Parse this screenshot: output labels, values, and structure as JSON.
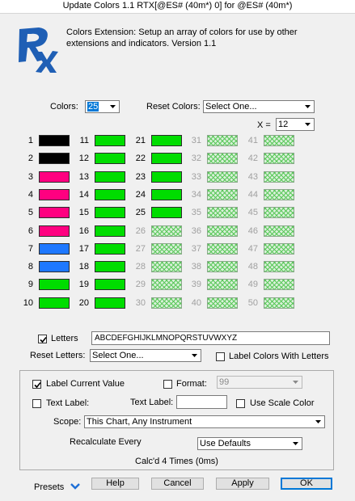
{
  "window": {
    "title": "Update Colors 1.1 RTX[@ES# (40m*) 0] for @ES# (40m*)"
  },
  "header": {
    "logo_text": "RX",
    "description": "Colors Extension: Setup an array of colors for use by other extensions and indicators. Version 1.1"
  },
  "colors_control": {
    "label": "Colors:",
    "value": "25"
  },
  "reset_colors": {
    "label": "Reset Colors:",
    "value": "Select One..."
  },
  "x_control": {
    "label": "X =",
    "value": "12"
  },
  "swatches": [
    {
      "n": "1",
      "color": "#000000",
      "enabled": true
    },
    {
      "n": "2",
      "color": "#000000",
      "enabled": true
    },
    {
      "n": "3",
      "color": "#ff0080",
      "enabled": true
    },
    {
      "n": "4",
      "color": "#ff0080",
      "enabled": true
    },
    {
      "n": "5",
      "color": "#ff0080",
      "enabled": true
    },
    {
      "n": "6",
      "color": "#ff0080",
      "enabled": true
    },
    {
      "n": "7",
      "color": "#1e78ff",
      "enabled": true
    },
    {
      "n": "8",
      "color": "#1e78ff",
      "enabled": true
    },
    {
      "n": "9",
      "color": "#00dd00",
      "enabled": true
    },
    {
      "n": "10",
      "color": "#00dd00",
      "enabled": true
    },
    {
      "n": "11",
      "color": "#00dd00",
      "enabled": true
    },
    {
      "n": "12",
      "color": "#00dd00",
      "enabled": true
    },
    {
      "n": "13",
      "color": "#00dd00",
      "enabled": true
    },
    {
      "n": "14",
      "color": "#00dd00",
      "enabled": true
    },
    {
      "n": "15",
      "color": "#00dd00",
      "enabled": true
    },
    {
      "n": "16",
      "color": "#00dd00",
      "enabled": true
    },
    {
      "n": "17",
      "color": "#00dd00",
      "enabled": true
    },
    {
      "n": "18",
      "color": "#00dd00",
      "enabled": true
    },
    {
      "n": "19",
      "color": "#00dd00",
      "enabled": true
    },
    {
      "n": "20",
      "color": "#00dd00",
      "enabled": true
    },
    {
      "n": "21",
      "color": "#00dd00",
      "enabled": true
    },
    {
      "n": "22",
      "color": "#00dd00",
      "enabled": true
    },
    {
      "n": "23",
      "color": "#00dd00",
      "enabled": true
    },
    {
      "n": "24",
      "color": "#00dd00",
      "enabled": true
    },
    {
      "n": "25",
      "color": "#00dd00",
      "enabled": true
    },
    {
      "n": "26",
      "color": "#00dd00",
      "enabled": false
    },
    {
      "n": "27",
      "color": "#00dd00",
      "enabled": false
    },
    {
      "n": "28",
      "color": "#00dd00",
      "enabled": false
    },
    {
      "n": "29",
      "color": "#00dd00",
      "enabled": false
    },
    {
      "n": "30",
      "color": "#00dd00",
      "enabled": false
    },
    {
      "n": "31",
      "color": "#00dd00",
      "enabled": false
    },
    {
      "n": "32",
      "color": "#00dd00",
      "enabled": false
    },
    {
      "n": "33",
      "color": "#00dd00",
      "enabled": false
    },
    {
      "n": "34",
      "color": "#00dd00",
      "enabled": false
    },
    {
      "n": "35",
      "color": "#00dd00",
      "enabled": false
    },
    {
      "n": "36",
      "color": "#00dd00",
      "enabled": false
    },
    {
      "n": "37",
      "color": "#00dd00",
      "enabled": false
    },
    {
      "n": "38",
      "color": "#00dd00",
      "enabled": false
    },
    {
      "n": "39",
      "color": "#00dd00",
      "enabled": false
    },
    {
      "n": "40",
      "color": "#00dd00",
      "enabled": false
    },
    {
      "n": "41",
      "color": "#00dd00",
      "enabled": false
    },
    {
      "n": "42",
      "color": "#00dd00",
      "enabled": false
    },
    {
      "n": "43",
      "color": "#00dd00",
      "enabled": false
    },
    {
      "n": "44",
      "color": "#00dd00",
      "enabled": false
    },
    {
      "n": "45",
      "color": "#00dd00",
      "enabled": false
    },
    {
      "n": "46",
      "color": "#00dd00",
      "enabled": false
    },
    {
      "n": "47",
      "color": "#00dd00",
      "enabled": false
    },
    {
      "n": "48",
      "color": "#00dd00",
      "enabled": false
    },
    {
      "n": "49",
      "color": "#00dd00",
      "enabled": false
    },
    {
      "n": "50",
      "color": "#00dd00",
      "enabled": false
    }
  ],
  "letters": {
    "label": "Letters",
    "checked": true,
    "value": "ABCDEFGHIJKLMNOPQRSTUVWXYZ"
  },
  "reset_letters": {
    "label": "Reset Letters:",
    "value": "Select One..."
  },
  "label_colors_with_letters": {
    "label": "Label Colors With Letters",
    "checked": false
  },
  "label_current_value": {
    "label": "Label Current Value",
    "checked": true
  },
  "format": {
    "label": "Format:",
    "checked": false,
    "value": "99"
  },
  "text_label_check": {
    "label": "Text Label:",
    "checked": false
  },
  "text_label_field": {
    "label": "Text Label:",
    "value": ""
  },
  "use_scale_color": {
    "label": "Use Scale Color",
    "checked": false
  },
  "scope": {
    "label": "Scope:",
    "value": "This Chart, Any Instrument"
  },
  "recalculate": {
    "label": "Recalculate Every",
    "value": "Use Defaults"
  },
  "calc_status": "Calc'd 4 Times (0ms)",
  "footer": {
    "presets_label": "Presets",
    "help_label": "Help",
    "cancel_label": "Cancel",
    "apply_label": "Apply",
    "ok_label": "OK"
  },
  "theme": {
    "accent": "#0078d7",
    "logo_blue": "#1f5fb5"
  }
}
